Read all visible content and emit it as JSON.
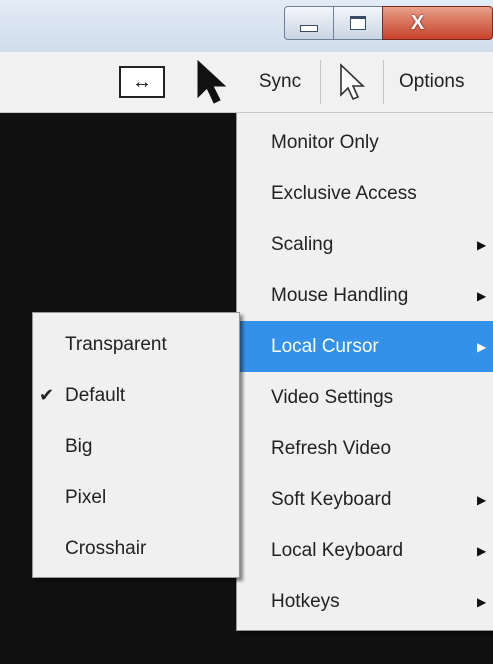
{
  "window": {
    "minimize_icon": "minimize-icon",
    "maximize_icon": "maximize-icon",
    "close_label": "X"
  },
  "toolbar": {
    "fit_icon": "fit-window-icon",
    "fit_glyph": "↔",
    "cursor_icon": "arrow-cursor-icon",
    "sync_label": "Sync",
    "cursor2_icon": "hand-cursor-outline-icon",
    "options_label": "Options"
  },
  "menu": {
    "items": [
      {
        "label": "Monitor Only",
        "has_submenu": false
      },
      {
        "label": "Exclusive Access",
        "has_submenu": false
      },
      {
        "label": "Scaling",
        "has_submenu": true
      },
      {
        "label": "Mouse Handling",
        "has_submenu": true
      },
      {
        "label": "Local Cursor",
        "has_submenu": true,
        "highlighted": true
      },
      {
        "label": "Video Settings",
        "has_submenu": false
      },
      {
        "label": "Refresh Video",
        "has_submenu": false
      },
      {
        "label": "Soft Keyboard",
        "has_submenu": true
      },
      {
        "label": "Local Keyboard",
        "has_submenu": true
      },
      {
        "label": "Hotkeys",
        "has_submenu": true
      }
    ],
    "arrow_glyph": "▶"
  },
  "submenu": {
    "items": [
      {
        "label": "Transparent",
        "checked": false
      },
      {
        "label": "Default",
        "checked": true
      },
      {
        "label": "Big",
        "checked": false
      },
      {
        "label": "Pixel",
        "checked": false
      },
      {
        "label": "Crosshair",
        "checked": false
      }
    ],
    "check_glyph": "✔"
  },
  "colors": {
    "highlight": "#3391ea",
    "screen_bg": "#101010",
    "menu_bg": "#f0f0f0"
  }
}
